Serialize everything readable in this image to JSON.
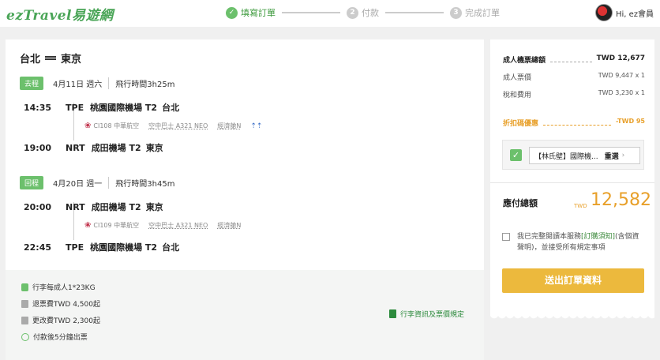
{
  "header": {
    "logo": "ezTravel易遊網",
    "steps": [
      {
        "num": "✓",
        "label": "填寫訂單"
      },
      {
        "num": "2",
        "label": "付款"
      },
      {
        "num": "3",
        "label": "完成訂單"
      }
    ],
    "greeting": "Hi, ez會員"
  },
  "trip": {
    "route_from": "台北",
    "route_to": "東京",
    "outbound": {
      "tag": "去程",
      "date": "4月11日 週六",
      "duration": "飛行時間3h25m",
      "dep_time": "14:35",
      "dep_code": "TPE",
      "dep_airport": "桃園國際機場 T2",
      "dep_city": "台北",
      "flight": "CI108 中華航空",
      "aircraft": "空中巴士 A321 NEO",
      "cabin": "經濟艙N",
      "seat_icon": "seat-icon",
      "arr_time": "19:00",
      "arr_code": "NRT",
      "arr_airport": "成田機場 T2",
      "arr_city": "東京"
    },
    "inbound": {
      "tag": "回程",
      "date": "4月20日 週一",
      "duration": "飛行時間3h45m",
      "dep_time": "20:00",
      "dep_code": "NRT",
      "dep_airport": "成田機場 T2",
      "dep_city": "東京",
      "flight": "CI109 中華航空",
      "aircraft": "空中巴士 A321 NEO",
      "cabin": "經濟艙N",
      "arr_time": "22:45",
      "arr_code": "TPE",
      "arr_airport": "桃園國際機場 T2",
      "arr_city": "台北"
    }
  },
  "fees": {
    "baggage": "行李每成人1*23KG",
    "refund": "退票費TWD 4,500起",
    "change": "更改費TWD 2,300起",
    "ticketing": "付款後5分鐘出票",
    "rules_link": "行李資訊及票價規定"
  },
  "summary": {
    "adult_total_label": "成人機票總額",
    "adult_total": "TWD 12,677",
    "fare_label": "成人票價",
    "fare": "TWD 9,447 x 1",
    "tax_label": "稅和費用",
    "tax": "TWD 3,230 x 1",
    "discount_label": "折扣碼優惠",
    "discount": "-TWD 95",
    "coupon_name": "【林氏壁】國際機...",
    "coupon_reselect": "重選",
    "payable_label": "應付總額",
    "payable_currency": "TWD",
    "payable": "12,582",
    "agree_prefix": "我已完整閱讀本服務",
    "agree_link": "[訂購須知]",
    "agree_suffix": "(含個資聲明)，並接受所有規定事項",
    "submit_label": "送出訂單資料"
  },
  "colors": {
    "brand_green": "#4aa557",
    "accent_orange": "#e8a02a",
    "submit_yellow": "#ecb93d"
  }
}
